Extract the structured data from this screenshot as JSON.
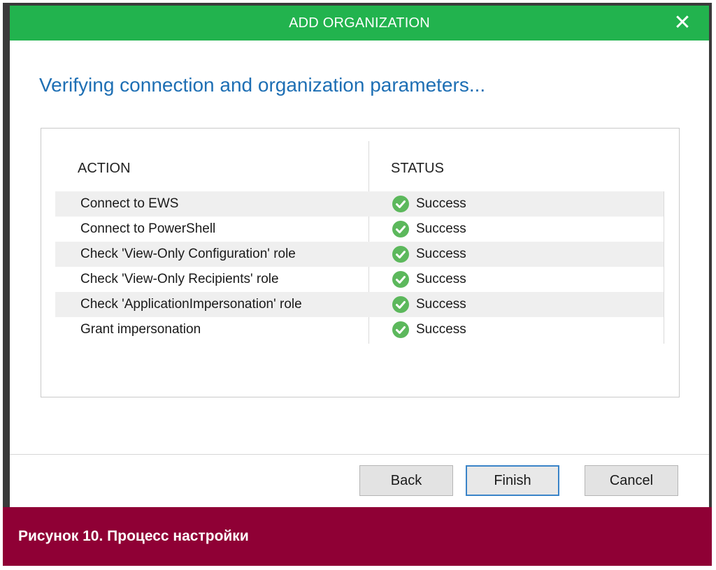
{
  "window": {
    "title": "ADD ORGANIZATION",
    "close_glyph": "✕"
  },
  "heading": "Verifying connection and organization parameters...",
  "table": {
    "columns": [
      "ACTION",
      "STATUS"
    ],
    "rows": [
      {
        "action": "Connect to EWS",
        "status": "Success"
      },
      {
        "action": "Connect to PowerShell",
        "status": "Success"
      },
      {
        "action": "Check 'View-Only Configuration' role",
        "status": "Success"
      },
      {
        "action": "Check 'View-Only Recipients' role",
        "status": "Success"
      },
      {
        "action": "Check 'ApplicationImpersonation' role",
        "status": "Success"
      },
      {
        "action": "Grant impersonation",
        "status": "Success"
      }
    ],
    "status_icon": "check-circle-icon"
  },
  "buttons": {
    "back": "Back",
    "finish": "Finish",
    "cancel": "Cancel"
  },
  "caption": "Рисунок 10. Процесс настройки",
  "colors": {
    "titlebar": "#22b34e",
    "heading": "#1e6fb4",
    "success": "#5cb85c",
    "caption_bar": "#8f0035",
    "default_button_border": "#3a84c8"
  }
}
